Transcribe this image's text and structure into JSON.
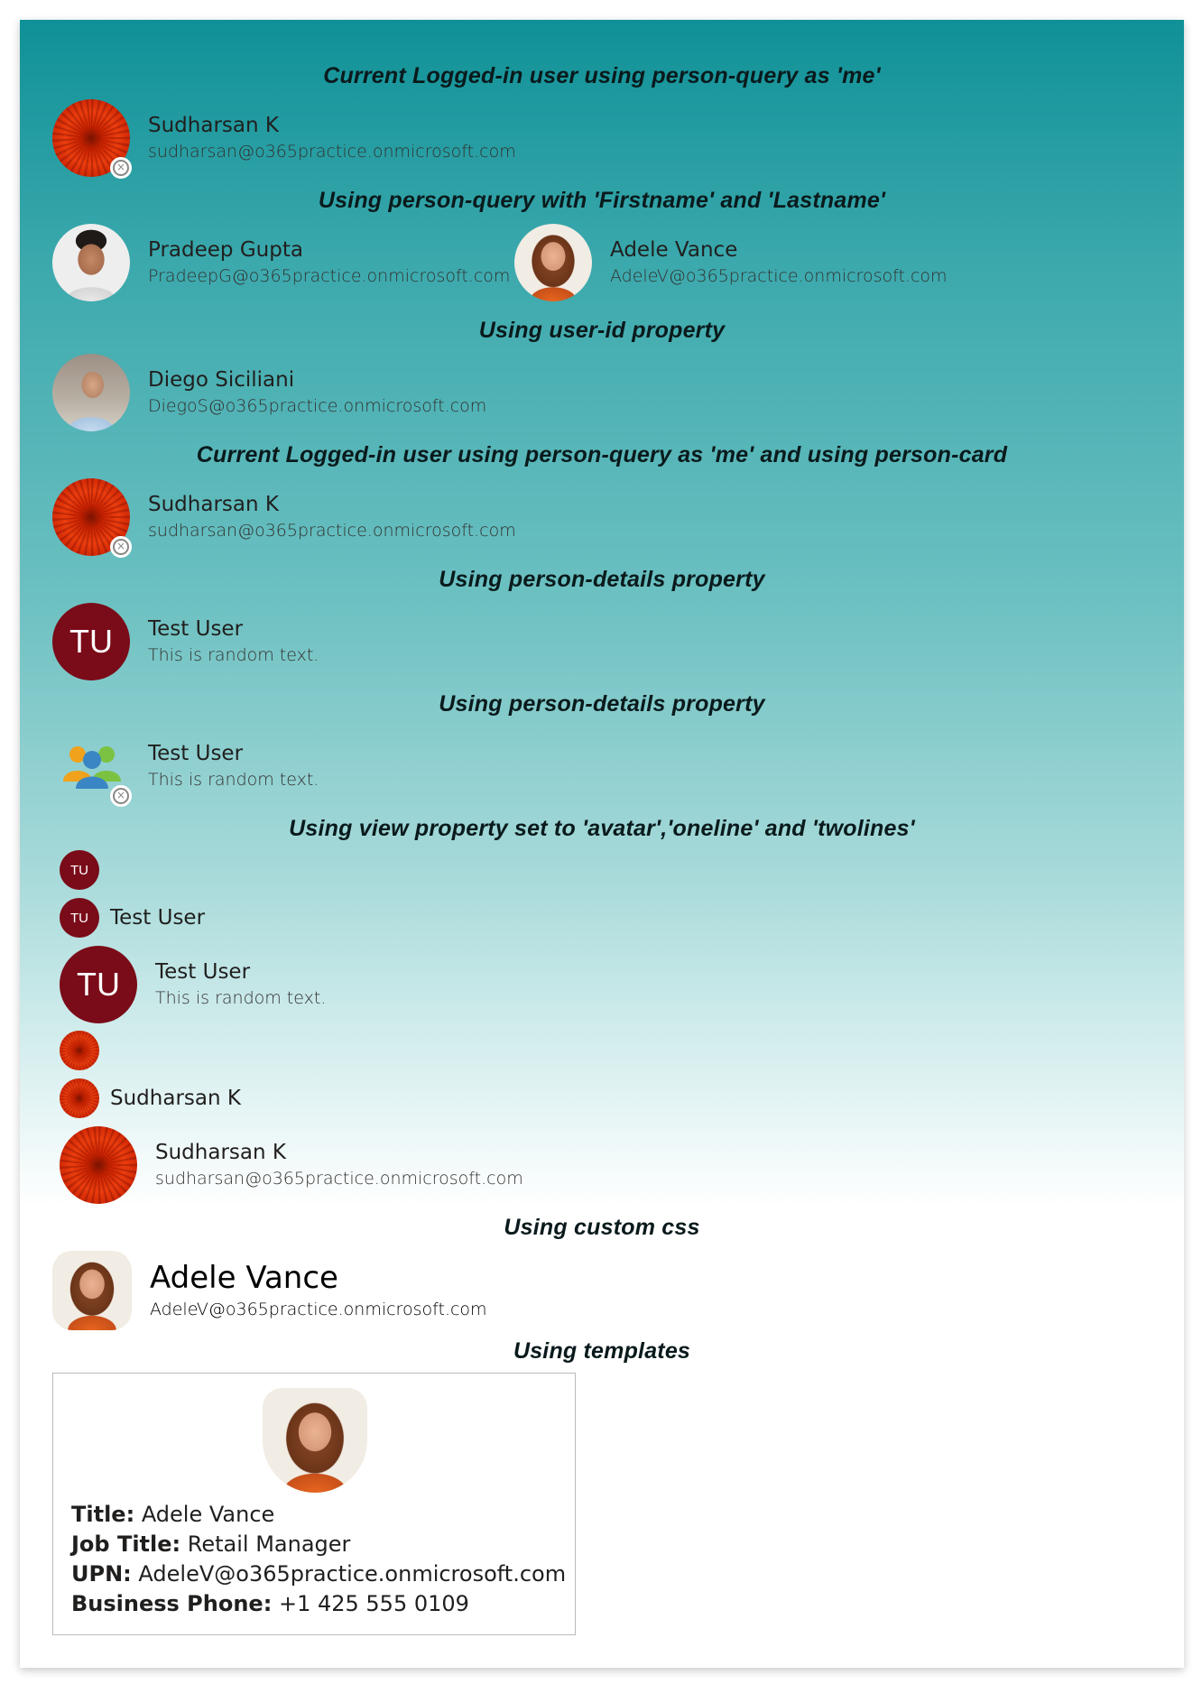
{
  "sections": {
    "me": "Current Logged-in user using person-query as 'me'",
    "names": "Using person-query with 'Firstname' and 'Lastname'",
    "userid": "Using user-id property",
    "card": "Current Logged-in user using person-query as 'me' and using person-card",
    "details1": "Using person-details property",
    "details2": "Using person-details property",
    "view": "Using view property set to 'avatar','oneline' and 'twolines'",
    "css": "Using custom css",
    "templates": "Using templates"
  },
  "people": {
    "sudharsan": {
      "name": "Sudharsan K",
      "email": "sudharsan@o365practice.onmicrosoft.com"
    },
    "pradeep": {
      "name": "Pradeep Gupta",
      "email": "PradeepG@o365practice.onmicrosoft.com"
    },
    "adele": {
      "name": "Adele Vance",
      "email": "AdeleV@o365practice.onmicrosoft.com"
    },
    "diego": {
      "name": "Diego Siciliani",
      "email": "DiegoS@o365practice.onmicrosoft.com"
    },
    "test": {
      "name": "Test User",
      "initials": "TU",
      "text": "This is random text."
    }
  },
  "template_card": {
    "title_label": "Title:",
    "title_value": "Adele Vance",
    "job_label": "Job Title:",
    "job_value": "Retail Manager",
    "upn_label": "UPN:",
    "upn_value": "AdeleV@o365practice.onmicrosoft.com",
    "phone_label": "Business Phone:",
    "phone_value": "+1 425 555 0109"
  },
  "icons": {
    "presence": "presence-offline-icon",
    "group": "group-people-icon"
  },
  "colors": {
    "gradient_top": "#0f9197",
    "initials_bg": "#7a0b18",
    "heading": "#0a1a1c"
  }
}
